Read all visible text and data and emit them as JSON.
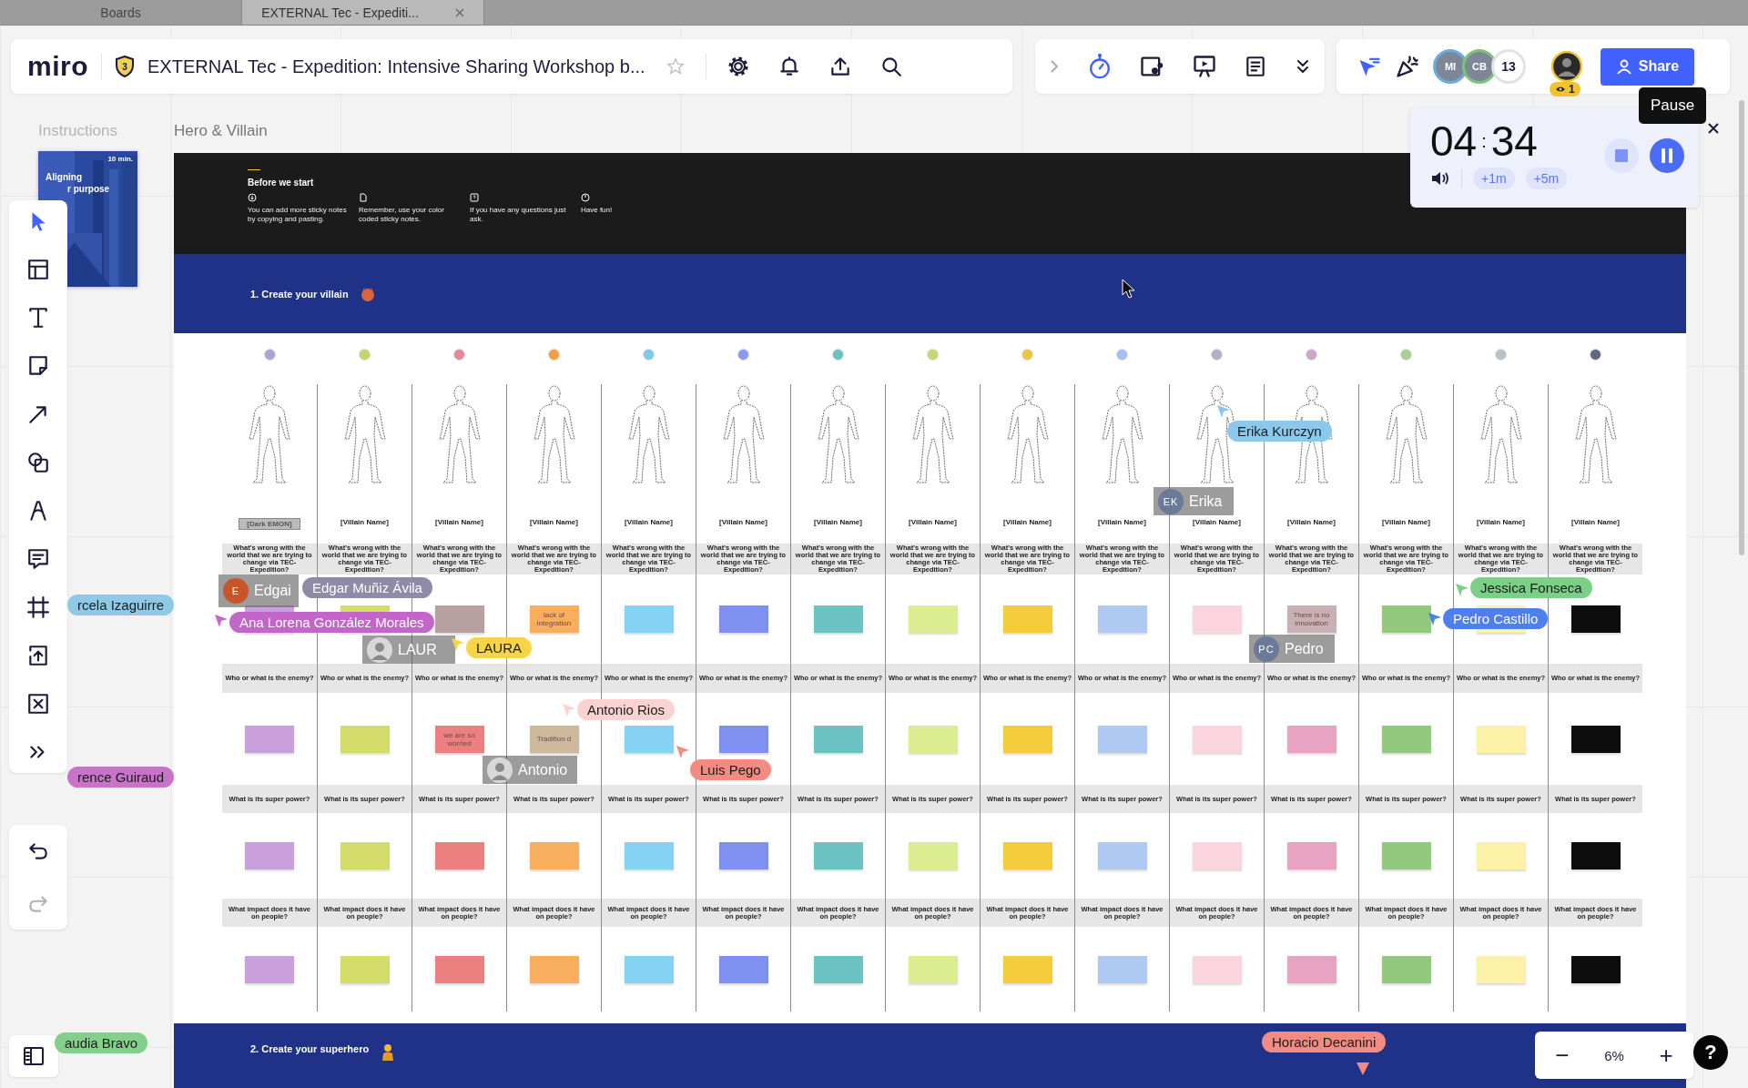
{
  "browser_tabs": [
    {
      "label": "Boards",
      "selected": false
    },
    {
      "label": "EXTERNAL Tec - Expediti...",
      "selected": true
    }
  ],
  "toolbar": {
    "logo": "miro",
    "plan_badge": "3",
    "board_title": "EXTERNAL Tec - Expedition: Intensive Sharing Workshop b..."
  },
  "collaborators": {
    "avatars": [
      {
        "initials": "MI",
        "color": "#6aaee0"
      },
      {
        "initials": "CB",
        "color": "#7cc47c"
      }
    ],
    "more_count": "13",
    "viewer_count": "1",
    "share": "Share"
  },
  "timer": {
    "minutes": "04",
    "separator": ":",
    "seconds": "34",
    "add_buttons": [
      "+1m",
      "+5m"
    ],
    "tooltip": "Pause"
  },
  "left_toolbar": {
    "tools": [
      {
        "selected": true
      },
      {
        "selected": false
      },
      {
        "selected": false
      },
      {
        "selected": false
      },
      {
        "selected": false
      },
      {
        "selected": false
      },
      {
        "selected": false
      },
      {
        "selected": false
      },
      {
        "selected": false
      },
      {
        "selected": false
      },
      {
        "selected": false
      },
      {
        "selected": false
      }
    ]
  },
  "frame_labels": [
    {
      "label": "Instructions",
      "muted": true
    },
    {
      "label": "Hero & Villain",
      "muted": false
    }
  ],
  "instructions_card": {
    "badge": "10 min.",
    "title_lines": [
      "Aligning",
      "r purpose"
    ]
  },
  "intro": {
    "heading": "Before we start",
    "tips": [
      "You can add more sticky notes by copying and pasting.",
      "Remember, use your color coded sticky notes.",
      "If you have any questions just ask.",
      "Have fun!"
    ]
  },
  "sections": [
    {
      "title": "1. Create your villain"
    },
    {
      "title": "2. Create your superhero"
    }
  ],
  "columns": [
    {
      "color": "#a9a3d6",
      "name_label": "[Dark EMON]",
      "prompts": [
        "What's wrong with the world that we are trying to change via TEC-Expedition?",
        "Who or what is the enemy?",
        "What is its super power?",
        "What impact does it have on people?"
      ],
      "notes": [
        {
          "color": "#c9a0dc"
        },
        {
          "color": "#c9a0dc"
        },
        {
          "color": "#c9a0dc"
        },
        {
          "color": "#c9a0dc"
        }
      ]
    },
    {
      "color": "#c8d36a",
      "name_label": "[Villain Name]",
      "prompts": [
        "What's wrong with the world that we are trying to change via TEC-Expedition?",
        "Who or what is the enemy?",
        "What is its super power?",
        "What impact does it have on people?"
      ],
      "notes": [
        {
          "color": "#d4dd6a"
        },
        {
          "color": "#d4dd6a"
        },
        {
          "color": "#d4dd6a"
        },
        {
          "color": "#d4dd6a"
        }
      ]
    },
    {
      "color": "#e58a9a",
      "name_label": "[Villain Name]",
      "prompts": [
        "What's wrong with the world that we are trying to change via TEC-Expedition?",
        "Who or what is the enemy?",
        "What is its super power?",
        "What impact does it have on people?"
      ],
      "notes": [
        {
          "color": "#b8a0a0"
        },
        {
          "color": "#ec8080",
          "text": "we are so worried"
        },
        {
          "color": "#ec8080"
        },
        {
          "color": "#ec8080"
        }
      ]
    },
    {
      "color": "#f0a040",
      "name_label": "[Villain Name]",
      "prompts": [
        "What's wrong with the world that we are trying to change via TEC-Expedition?",
        "Who or what is the enemy?",
        "What is its super power?",
        "What impact does it have on people?"
      ],
      "notes": [
        {
          "color": "#f8ae5c",
          "text": "lack of integration"
        },
        {
          "color": "#cdb89c",
          "text": "Tradition d"
        },
        {
          "color": "#f8ae5c"
        },
        {
          "color": "#f8ae5c"
        }
      ]
    },
    {
      "color": "#7fc8ee",
      "name_label": "[Villain Name]",
      "prompts": [
        "What's wrong with the world that we are trying to change via TEC-Expedition?",
        "Who or what is the enemy?",
        "What is its super power?",
        "What impact does it have on people?"
      ],
      "notes": [
        {
          "color": "#86d2f5"
        },
        {
          "color": "#86d2f5"
        },
        {
          "color": "#86d2f5"
        },
        {
          "color": "#86d2f5"
        }
      ]
    },
    {
      "color": "#8a9af0",
      "name_label": "[Villain Name]",
      "prompts": [
        "What's wrong with the world that we are trying to change via TEC-Expedition?",
        "Who or what is the enemy?",
        "What is its super power?",
        "What impact does it have on people?"
      ],
      "notes": [
        {
          "color": "#7e90f0"
        },
        {
          "color": "#7e90f0"
        },
        {
          "color": "#7e90f0"
        },
        {
          "color": "#7e90f0"
        }
      ]
    },
    {
      "color": "#70c0c0",
      "name_label": "[Villain Name]",
      "prompts": [
        "What's wrong with the world that we are trying to change via TEC-Expedition?",
        "Who or what is the enemy?",
        "What is its super power?",
        "What impact does it have on people?"
      ],
      "notes": [
        {
          "color": "#6cc3c3"
        },
        {
          "color": "#6cc3c3"
        },
        {
          "color": "#6cc3c3"
        },
        {
          "color": "#6cc3c3"
        }
      ]
    },
    {
      "color": "#c8d870",
      "name_label": "[Villain Name]",
      "prompts": [
        "What's wrong with the world that we are trying to change via TEC-Expedition?",
        "Who or what is the enemy?",
        "What is its super power?",
        "What impact does it have on people?"
      ],
      "notes": [
        {
          "color": "#dcec90"
        },
        {
          "color": "#dcec90"
        },
        {
          "color": "#dcec90"
        },
        {
          "color": "#dcec90"
        }
      ]
    },
    {
      "color": "#e8c840",
      "name_label": "[Villain Name]",
      "prompts": [
        "What's wrong with the world that we are trying to change via TEC-Expedition?",
        "Who or what is the enemy?",
        "What is its super power?",
        "What impact does it have on people?"
      ],
      "notes": [
        {
          "color": "#f4cc3c"
        },
        {
          "color": "#f4cc3c"
        },
        {
          "color": "#f4cc3c"
        },
        {
          "color": "#f4cc3c"
        }
      ]
    },
    {
      "color": "#a8c0f0",
      "name_label": "[Villain Name]",
      "prompts": [
        "What's wrong with the world that we are trying to change via TEC-Expedition?",
        "Who or what is the enemy?",
        "What is its super power?",
        "What impact does it have on people?"
      ],
      "notes": [
        {
          "color": "#aecaf2"
        },
        {
          "color": "#aecaf2"
        },
        {
          "color": "#aecaf2"
        },
        {
          "color": "#aecaf2"
        }
      ]
    },
    {
      "color": "#b0b0c8",
      "name_label": "[Villain Name]",
      "prompts": [
        "What's wrong with the world that we are trying to change via TEC-Expedition?",
        "Who or what is the enemy?",
        "What is its super power?",
        "What impact does it have on people?"
      ],
      "notes": [
        {
          "color": "#fbd5de"
        },
        {
          "color": "#fbd5de"
        },
        {
          "color": "#fbd5de"
        },
        {
          "color": "#fbd5de"
        }
      ]
    },
    {
      "color": "#c8a8c8",
      "name_label": "[Villain Name]",
      "prompts": [
        "What's wrong with the world that we are trying to change via TEC-Expedition?",
        "Who or what is the enemy?",
        "What is its super power?",
        "What impact does it have on people?"
      ],
      "notes": [
        {
          "color": "#c8b0b4",
          "text": "There is no innovation"
        },
        {
          "color": "#e8a3c2"
        },
        {
          "color": "#e8a3c2"
        },
        {
          "color": "#e8a3c2"
        }
      ]
    },
    {
      "color": "#a8d090",
      "name_label": "[Villain Name]",
      "prompts": [
        "What's wrong with the world that we are trying to change via TEC-Expedition?",
        "Who or what is the enemy?",
        "What is its super power?",
        "What impact does it have on people?"
      ],
      "notes": [
        {
          "color": "#93c97c"
        },
        {
          "color": "#93c97c"
        },
        {
          "color": "#93c97c"
        },
        {
          "color": "#93c97c"
        }
      ]
    },
    {
      "color": "#b8c0c8",
      "name_label": "[Villain Name]",
      "prompts": [
        "What's wrong with the world that we are trying to change via TEC-Expedition?",
        "Who or what is the enemy?",
        "What is its super power?",
        "What impact does it have on people?"
      ],
      "notes": [
        {
          "color": "#fcf1a6"
        },
        {
          "color": "#fcf1a6"
        },
        {
          "color": "#fcf1a6"
        },
        {
          "color": "#fcf1a6"
        }
      ]
    },
    {
      "color": "#606880",
      "name_label": "[Villain Name]",
      "prompts": [
        "What's wrong with the world that we are trying to change via TEC-Expedition?",
        "Who or what is the enemy?",
        "What is its super power?",
        "What impact does it have on people?"
      ],
      "notes": [
        {
          "color": "#0d0d0d"
        },
        {
          "color": "#0d0d0d"
        },
        {
          "color": "#0d0d0d"
        },
        {
          "color": "#0d0d0d"
        }
      ]
    }
  ],
  "selections": [
    {
      "kind": "initials",
      "initials": "E",
      "color": "#c8552a",
      "name": "Edgai"
    },
    {
      "name": "LAUR"
    },
    {
      "name": "Antonio"
    },
    {
      "kind": "initials",
      "initials": "EK",
      "color": "#6b7a99",
      "name": "Erika"
    },
    {
      "kind": "initials",
      "initials": "PC",
      "color": "#6b7a99",
      "name": "Pedro"
    }
  ],
  "cursors": [
    {
      "name": "rcela Izaguirre",
      "color": "#8ecae6",
      "pointer": false
    },
    {
      "name": "rence Guiraud",
      "color": "#c873c9",
      "pointer": false
    },
    {
      "name": "audia Bravo",
      "color": "#84d08a",
      "pointer": false
    },
    {
      "name": "Edgar Muñiz Ávila",
      "color": "#8e8aa8",
      "pointer": false
    },
    {
      "name": "Ana Lorena González Morales",
      "color": "#c266c9",
      "pointer": true
    },
    {
      "name": "LAURA",
      "color": "#f5d547",
      "pointer": true
    },
    {
      "name": "Antonio Rios",
      "color": "#fbd2d2",
      "pointer": true
    },
    {
      "name": "Luis Pego",
      "color": "#f28b82",
      "pointer": true
    },
    {
      "name": "Erika Kurczyn",
      "color": "#8cc8ec",
      "pointer": true
    },
    {
      "name": "Jessica Fonseca",
      "color": "#7ccf86",
      "pointer": true
    },
    {
      "name": "Pedro Castillo",
      "color": "#4f7ef0",
      "pointer": true
    },
    {
      "name": "Horacio Decanini",
      "color": "#f28b82",
      "pointer": true
    }
  ],
  "zoom": {
    "out": "−",
    "level": "6%",
    "in": "+"
  },
  "help": "?"
}
